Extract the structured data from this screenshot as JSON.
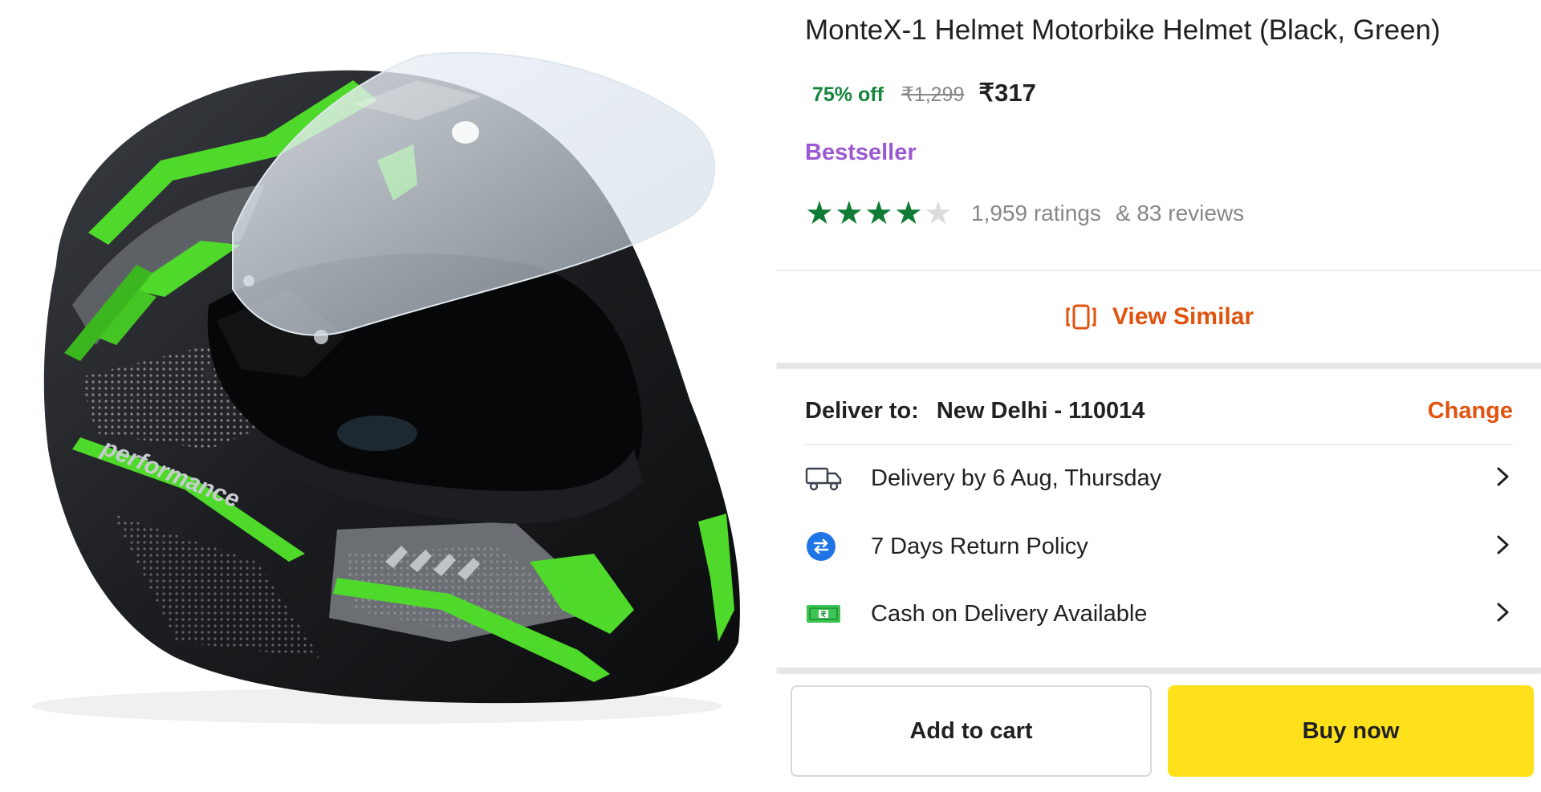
{
  "product": {
    "title": "MonteX-1 Helmet Motorbike Helmet (Black, Green)",
    "image_text": "performance"
  },
  "pricing": {
    "discount": "75% off",
    "mrp": "₹1,299",
    "price": "₹317"
  },
  "badge": "Bestseller",
  "rating": {
    "stars": 4,
    "max_stars": 5,
    "ratings_text": "1,959 ratings",
    "reviews_text": "& 83 reviews",
    "star_color": "#0f7b34"
  },
  "view_similar": {
    "label": "View Similar",
    "icon": "view-similar-icon"
  },
  "delivery": {
    "label": "Deliver to:",
    "location": "New Delhi - 110014",
    "change_label": "Change",
    "items": [
      {
        "icon": "truck-icon",
        "text": "Delivery by 6 Aug, Thursday"
      },
      {
        "icon": "return-icon",
        "text": "7 Days Return Policy"
      },
      {
        "icon": "cash-icon",
        "text": "Cash on Delivery Available"
      }
    ]
  },
  "actions": {
    "add_to_cart": "Add to cart",
    "buy_now": "Buy now"
  },
  "colors": {
    "accent_orange": "#e0530f",
    "discount_green": "#16843c",
    "badge_purple": "#9b59d0",
    "buy_yellow": "#ffe11b"
  }
}
